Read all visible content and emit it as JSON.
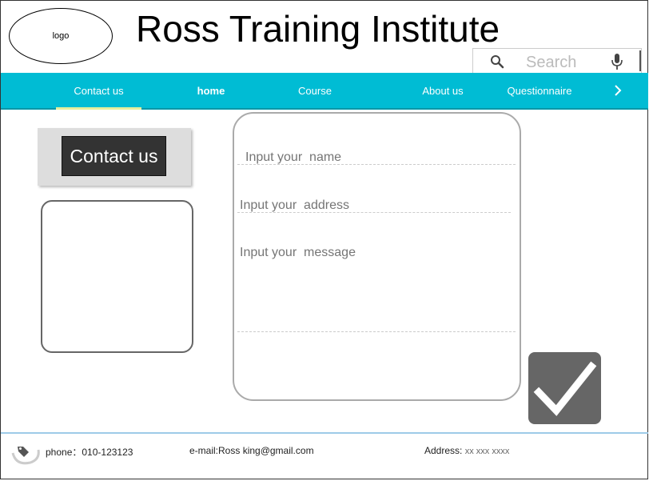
{
  "header": {
    "logo_text": "logo",
    "title": "Ross Training Institute",
    "search_placeholder": "Search"
  },
  "nav": {
    "items": [
      {
        "label": "Contact us",
        "active": true
      },
      {
        "label": "home",
        "active": false
      },
      {
        "label": "Course",
        "active": false
      },
      {
        "label": "About us",
        "active": false
      },
      {
        "label": "Questionnaire",
        "active": false
      }
    ],
    "next_icon": "chevron-right-icon"
  },
  "sidebar": {
    "contact_button": "Contact us"
  },
  "form": {
    "name_placeholder": "Input your  name",
    "address_placeholder": "Input your  address",
    "message_placeholder": "Input your  message",
    "submit_icon": "check-icon"
  },
  "footer": {
    "phone_label": "phone：",
    "phone_value": "010-123123",
    "email_label": "e-mail:",
    "email_value": "Ross  king@gmail.com",
    "address_label": "Address: ",
    "address_value": "xx xxx xxxx"
  },
  "colors": {
    "nav_bg": "#00bcd4",
    "active_underline": "#e6ee9c",
    "submit_bg": "#666666"
  }
}
